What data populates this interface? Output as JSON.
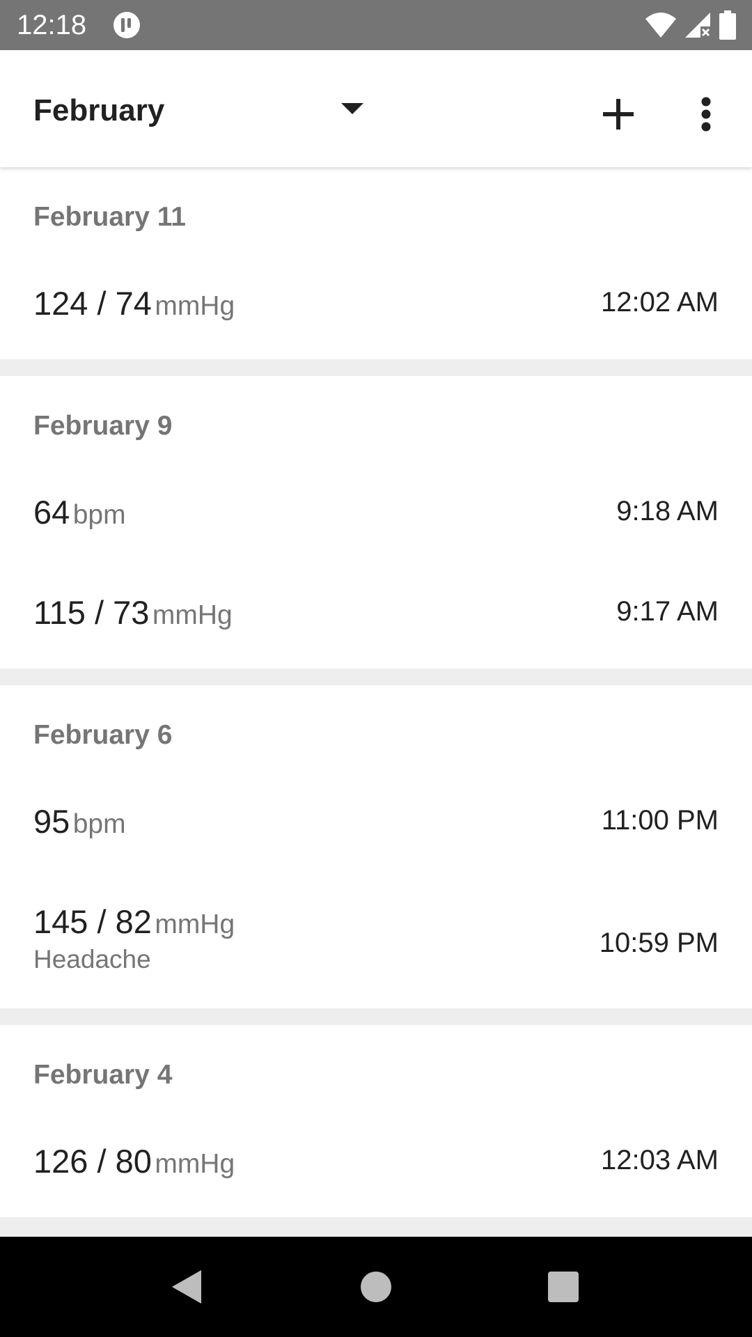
{
  "status_bar": {
    "time": "12:18",
    "icons": [
      "app-notification-icon",
      "wifi-icon",
      "cell-signal-icon",
      "battery-icon"
    ]
  },
  "app_bar": {
    "month": "February",
    "icons": [
      "dropdown-icon",
      "add-icon",
      "more-vertical-icon"
    ]
  },
  "days": [
    {
      "date": "February 11",
      "entries": [
        {
          "value": "124 / 74",
          "unit": "mmHg",
          "note": "",
          "time": "12:02 AM"
        }
      ]
    },
    {
      "date": "February 9",
      "entries": [
        {
          "value": "64",
          "unit": "bpm",
          "note": "",
          "time": "9:18 AM"
        },
        {
          "value": "115 / 73",
          "unit": "mmHg",
          "note": "",
          "time": "9:17 AM"
        }
      ]
    },
    {
      "date": "February 6",
      "entries": [
        {
          "value": "95",
          "unit": "bpm",
          "note": "",
          "time": "11:00 PM"
        },
        {
          "value": "145 / 82",
          "unit": "mmHg",
          "note": "Headache",
          "time": "10:59 PM"
        }
      ]
    },
    {
      "date": "February 4",
      "entries": [
        {
          "value": "126 / 80",
          "unit": "mmHg",
          "note": "",
          "time": "12:03 AM"
        }
      ]
    }
  ],
  "nav_bar": {
    "icons": [
      "back-icon",
      "home-icon",
      "recents-icon"
    ]
  },
  "colors": {
    "status_bar": "#757575",
    "divider": "#eeeeee",
    "secondary_text": "#757575",
    "primary_text": "#212121"
  }
}
